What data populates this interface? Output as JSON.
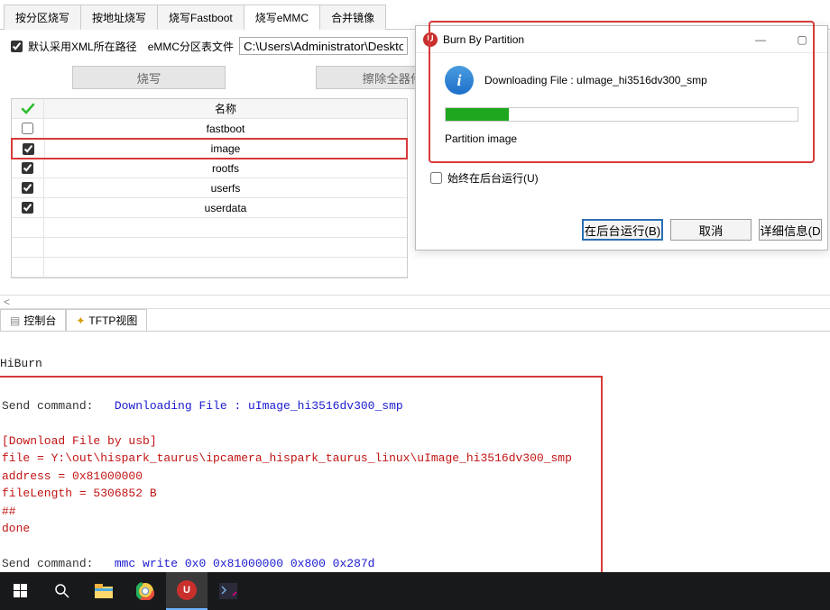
{
  "tabs": {
    "t0": "按分区烧写",
    "t1": "按地址烧写",
    "t2": "烧写Fastboot",
    "t3": "烧写eMMC",
    "t4": "合并镜像"
  },
  "options": {
    "xml_path_label": "默认采用XML所在路径",
    "emmc_label": "eMMC分区表文件",
    "path_value": "C:\\Users\\Administrator\\Desktop"
  },
  "buttons": {
    "burn": "烧写",
    "erase": "擦除全器件"
  },
  "table": {
    "header": "名称",
    "rows": [
      {
        "checked": false,
        "name": "fastboot"
      },
      {
        "checked": true,
        "name": "image"
      },
      {
        "checked": true,
        "name": "rootfs"
      },
      {
        "checked": true,
        "name": "userfs"
      },
      {
        "checked": true,
        "name": "userdata"
      }
    ]
  },
  "dialog": {
    "title": "Burn By Partition",
    "msg": "Downloading File : uImage_hi3516dv300_smp",
    "progress_pct": 18,
    "stage": "Partition image",
    "always_back": "始终在后台运行(U)",
    "btn_back": "在后台运行(B)",
    "btn_cancel": "取消",
    "btn_detail": "详细信息(D"
  },
  "out_tabs": {
    "console": "控制台",
    "tftp": "TFTP视图"
  },
  "console": {
    "hiburn": "HiBurn",
    "l1a": "Send command:   ",
    "l1b": "Downloading File : uImage_hi3516dv300_smp",
    "l2": "[Download File by usb]",
    "l3": "file = Y:\\out\\hispark_taurus\\ipcamera_hispark_taurus_linux\\uImage_hi3516dv300_smp",
    "l4": "address = 0x81000000",
    "l5": "fileLength = 5306852 B",
    "l6": "##",
    "l7": "done",
    "l8a": "Send command:   ",
    "l8b": "mmc write 0x0 0x81000000 0x800 0x287d"
  }
}
